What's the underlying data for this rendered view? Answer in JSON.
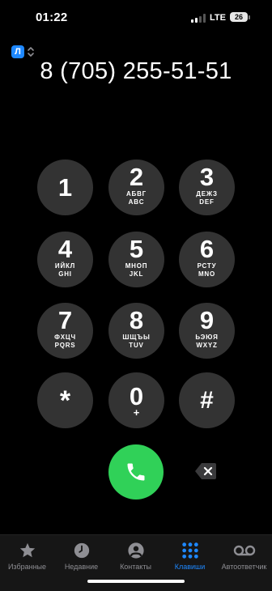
{
  "status": {
    "time": "01:22",
    "network": "LTE",
    "battery": "26"
  },
  "sim": {
    "label": "Л"
  },
  "dialed_number": "8 (705) 255-51-51",
  "keys": [
    {
      "digit": "1",
      "cyr": "",
      "lat": ""
    },
    {
      "digit": "2",
      "cyr": "АБВГ",
      "lat": "ABC"
    },
    {
      "digit": "3",
      "cyr": "ДЕЖЗ",
      "lat": "DEF"
    },
    {
      "digit": "4",
      "cyr": "ИЙКЛ",
      "lat": "GHI"
    },
    {
      "digit": "5",
      "cyr": "МНОП",
      "lat": "JKL"
    },
    {
      "digit": "6",
      "cyr": "РСТУ",
      "lat": "MNO"
    },
    {
      "digit": "7",
      "cyr": "ФХЦЧ",
      "lat": "PQRS"
    },
    {
      "digit": "8",
      "cyr": "ШЩЪЫ",
      "lat": "TUV"
    },
    {
      "digit": "9",
      "cyr": "ЬЭЮЯ",
      "lat": "WXYZ"
    },
    {
      "digit": "*",
      "cyr": "",
      "lat": ""
    },
    {
      "digit": "0",
      "cyr": "",
      "lat": "+"
    },
    {
      "digit": "#",
      "cyr": "",
      "lat": ""
    }
  ],
  "tabs": [
    {
      "label": "Избранные",
      "icon": "star-icon",
      "active": false
    },
    {
      "label": "Недавние",
      "icon": "clock-icon",
      "active": false
    },
    {
      "label": "Контакты",
      "icon": "person-icon",
      "active": false
    },
    {
      "label": "Клавиши",
      "icon": "keypad-icon",
      "active": true
    },
    {
      "label": "Автоответчик",
      "icon": "voicemail-icon",
      "active": false
    }
  ],
  "colors": {
    "accent": "#1e88ff",
    "call": "#30d158",
    "key_bg": "#333333"
  }
}
